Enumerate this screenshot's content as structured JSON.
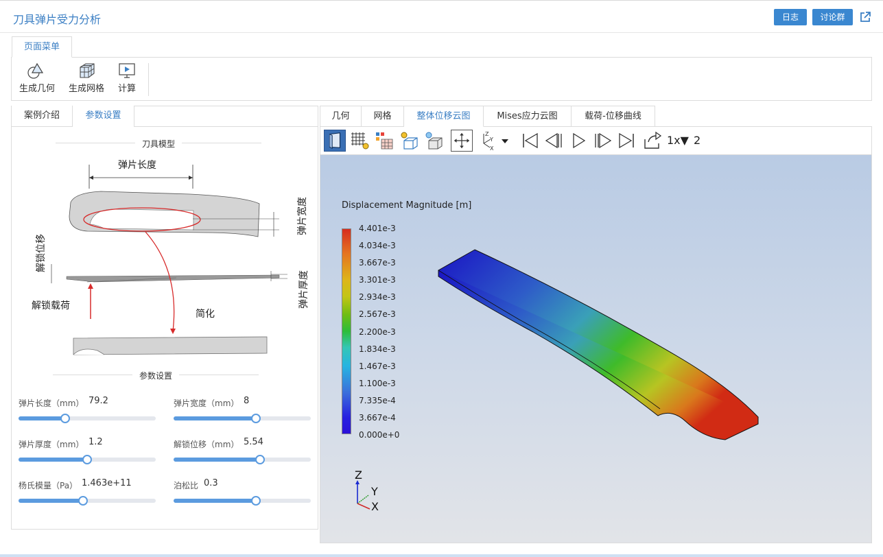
{
  "header": {
    "title": "刀具弹片受力分析",
    "log_label": "日志",
    "group_label": "讨论群"
  },
  "menu_tab": "页面菜单",
  "ribbon": [
    {
      "label": "生成几何",
      "icon": "geometry-icon"
    },
    {
      "label": "生成网格",
      "icon": "mesh-icon"
    },
    {
      "label": "计算",
      "icon": "compute-icon"
    }
  ],
  "left_tabs": [
    "案例介绍",
    "参数设置"
  ],
  "model_section": "刀具模型",
  "diagram": {
    "length": "弹片长度",
    "width": "弹片宽度",
    "disp": "解锁位移",
    "thickness": "弹片厚度",
    "load": "解锁载荷",
    "simplify": "简化"
  },
  "param_section": "参数设置",
  "params": [
    {
      "label": "弹片长度（mm）",
      "value": "79.2",
      "level": 0.34
    },
    {
      "label": "弹片宽度（mm）",
      "value": "8",
      "level": 0.6
    },
    {
      "label": "弹片厚度（mm）",
      "value": "1.2",
      "level": 0.5
    },
    {
      "label": "解锁位移（mm）",
      "value": "5.54",
      "level": 0.63
    },
    {
      "label": "杨氏模量（Pa）",
      "value": "1.463e+11",
      "level": 0.47
    },
    {
      "label": "泊松比",
      "value": "0.3",
      "level": 0.6
    }
  ],
  "right_tabs": [
    "几何",
    "网格",
    "整体位移云图",
    "Mises应力云图",
    "载荷-位移曲线"
  ],
  "toolbar": {
    "speed": "1x▼",
    "frame": "2"
  },
  "colorbar": {
    "title": "Displacement Magnitude [m]",
    "ticks": [
      "4.401e-3",
      "4.034e-3",
      "3.667e-3",
      "3.301e-3",
      "2.934e-3",
      "2.567e-3",
      "2.200e-3",
      "1.834e-3",
      "1.467e-3",
      "1.100e-3",
      "7.335e-4",
      "3.667e-4",
      "0.000e+0"
    ]
  },
  "axes": {
    "z": "Z",
    "y": "Y",
    "x": "X"
  },
  "colors": {
    "accent": "#3b7fc4",
    "button": "#3a87d0",
    "slider": "#5b9bdf"
  }
}
